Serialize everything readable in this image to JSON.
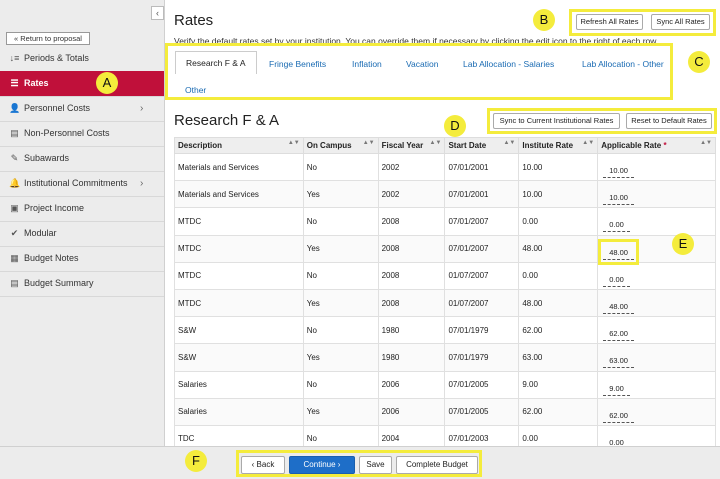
{
  "sidebar": {
    "return_label": "« Return to proposal",
    "collapse_label": "‹",
    "items": [
      {
        "label": "Periods & Totals",
        "icon": "sort-icon",
        "glyph": "↓≡",
        "active": false,
        "arrow": false
      },
      {
        "label": "Rates",
        "icon": "list-icon",
        "glyph": "☰",
        "active": true,
        "arrow": false
      },
      {
        "label": "Personnel Costs",
        "icon": "user-icon",
        "glyph": "👤",
        "active": false,
        "arrow": true
      },
      {
        "label": "Non-Personnel Costs",
        "icon": "document-icon",
        "glyph": "▤",
        "active": false,
        "arrow": false
      },
      {
        "label": "Subawards",
        "icon": "wrench-icon",
        "glyph": "✎",
        "active": false,
        "arrow": false
      },
      {
        "label": "Institutional Commitments",
        "icon": "bell-icon",
        "glyph": "🔔",
        "active": false,
        "arrow": true
      },
      {
        "label": "Project Income",
        "icon": "image-icon",
        "glyph": "▣",
        "active": false,
        "arrow": false
      },
      {
        "label": "Modular",
        "icon": "check-icon",
        "glyph": "✔",
        "active": false,
        "arrow": false
      },
      {
        "label": "Budget Notes",
        "icon": "grid-icon",
        "glyph": "▦",
        "active": false,
        "arrow": false
      },
      {
        "label": "Budget Summary",
        "icon": "summary-icon",
        "glyph": "▤",
        "active": false,
        "arrow": false
      }
    ]
  },
  "header": {
    "title": "Rates",
    "refresh_label": "Refresh All Rates",
    "sync_label": "Sync All Rates",
    "intro": "Verify the default rates set by your institution. You can override them if necessary by clicking the edit icon to the right of each row."
  },
  "tabs": [
    {
      "label": "Research F & A",
      "active": true
    },
    {
      "label": "Fringe Benefits",
      "active": false
    },
    {
      "label": "Inflation",
      "active": false
    },
    {
      "label": "Vacation",
      "active": false
    },
    {
      "label": "Lab Allocation - Salaries",
      "active": false
    },
    {
      "label": "Lab Allocation - Other",
      "active": false
    },
    {
      "label": "Other",
      "active": false
    }
  ],
  "section": {
    "title": "Research F & A",
    "sync_label": "Sync to Current Institutional Rates",
    "reset_label": "Reset to Default Rates"
  },
  "table": {
    "columns": [
      "Description",
      "On Campus",
      "Fiscal Year",
      "Start Date",
      "Institute Rate",
      "Applicable Rate"
    ],
    "required_marker": "*",
    "rows": [
      [
        "Materials and Services",
        "No",
        "2002",
        "07/01/2001",
        "10.00",
        "10.00"
      ],
      [
        "Materials and Services",
        "Yes",
        "2002",
        "07/01/2001",
        "10.00",
        "10.00"
      ],
      [
        "MTDC",
        "No",
        "2008",
        "07/01/2007",
        "0.00",
        "0.00"
      ],
      [
        "MTDC",
        "Yes",
        "2008",
        "07/01/2007",
        "48.00",
        "48.00"
      ],
      [
        "MTDC",
        "No",
        "2008",
        "01/07/2007",
        "0.00",
        "0.00"
      ],
      [
        "MTDC",
        "Yes",
        "2008",
        "01/07/2007",
        "48.00",
        "48.00"
      ],
      [
        "S&W",
        "No",
        "1980",
        "07/01/1979",
        "62.00",
        "62.00"
      ],
      [
        "S&W",
        "Yes",
        "1980",
        "07/01/1979",
        "63.00",
        "63.00"
      ],
      [
        "Salaries",
        "No",
        "2006",
        "07/01/2005",
        "9.00",
        "9.00"
      ],
      [
        "Salaries",
        "Yes",
        "2006",
        "07/01/2005",
        "62.00",
        "62.00"
      ],
      [
        "TDC",
        "No",
        "2004",
        "07/01/2003",
        "0.00",
        "0.00"
      ]
    ]
  },
  "footer": {
    "back_label": "Back",
    "continue_label": "Continue",
    "save_label": "Save",
    "complete_label": "Complete Budget"
  },
  "callouts": [
    "A",
    "B",
    "C",
    "D",
    "E",
    "F"
  ],
  "colors": {
    "accent": "#c0103a",
    "primary": "#1e6ec8",
    "highlight": "#f4ec3c",
    "link": "#1a6bb3"
  }
}
